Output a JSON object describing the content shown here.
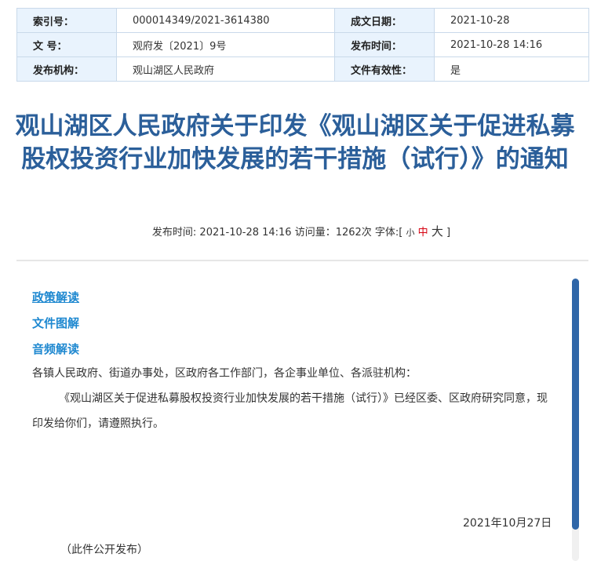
{
  "meta": {
    "index_label": "索引号：",
    "index_value": "000014349/2021-3614380",
    "date_label": "成文日期：",
    "date_value": "2021-10-28",
    "doc_no_label": "文 号：",
    "doc_no_value": "观府发〔2021〕9号",
    "publish_time_label": "发布时间：",
    "publish_time_value": "2021-10-28 14:16",
    "publisher_label": "发布机构：",
    "publisher_value": "观山湖区人民政府",
    "validity_label": "文件有效性：",
    "validity_value": "是"
  },
  "title": "观山湖区人民政府关于印发《观山湖区关于促进私募股权投资行业加快发展的若干措施（试行）》的通知",
  "info": {
    "publish_prefix": "发布时间: 2021-10-28 14:16 访问量：1262次 字体:[",
    "font_small": "小",
    "font_mid": "中",
    "font_big": "大",
    "suffix": "]"
  },
  "links": {
    "policy_interpretation": "政策解读",
    "file_illustration": "文件图解",
    "audio_interpretation": "音频解读"
  },
  "body": {
    "salutation": "各镇人民政府、街道办事处，区政府各工作部门，各企事业单位、各派驻机构：",
    "paragraph": "《观山湖区关于促进私募股权投资行业加快发展的若干措施（试行）》已经区委、区政府研究同意，现印发给你们，请遵照执行。"
  },
  "date": "2021年10月27日",
  "public_note": "（此件公开发布）",
  "colors": {
    "title": "#2b5f9a",
    "link": "#1e88d0",
    "label_bg": "#e9f3fd",
    "border": "#c9d9ea",
    "font_mid": "#d6000f",
    "scroll_thumb": "#2f66a8"
  }
}
